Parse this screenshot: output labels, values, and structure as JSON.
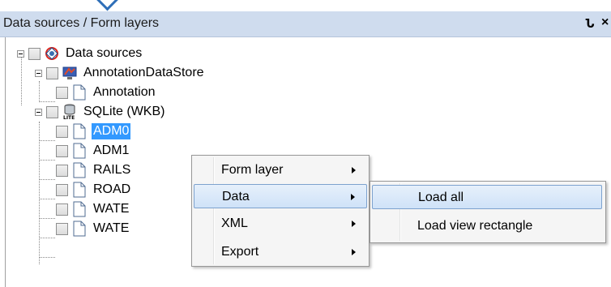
{
  "panel": {
    "title": "Data sources / Form layers",
    "pin_glyph": "Ն",
    "close_glyph": "×"
  },
  "tree": {
    "root": {
      "label": "Data sources",
      "icon": "data-sources-icon"
    },
    "groups": [
      {
        "label": "AnnotationDataStore",
        "icon": "annotation-store-icon",
        "children": [
          {
            "label": "Annotation",
            "icon": "document-icon"
          }
        ]
      },
      {
        "label": "SQLite (WKB)",
        "icon": "sqlite-database-icon",
        "children": [
          {
            "label": "ADM0",
            "icon": "document-icon",
            "selected": true
          },
          {
            "label": "ADM1",
            "icon": "document-icon"
          },
          {
            "label": "RAILS",
            "icon": "document-icon"
          },
          {
            "label": "ROAD",
            "icon": "document-icon"
          },
          {
            "label": "WATE",
            "icon": "document-icon"
          },
          {
            "label": "WATE",
            "icon": "document-icon"
          }
        ]
      }
    ]
  },
  "context_menu": {
    "items": [
      {
        "label": "Form layer",
        "has_submenu": true
      },
      {
        "label": "Data",
        "has_submenu": true,
        "highlighted": true
      },
      {
        "label": "XML",
        "has_submenu": true
      },
      {
        "label": "Export",
        "has_submenu": true
      }
    ]
  },
  "submenu": {
    "items": [
      {
        "label": "Load all",
        "highlighted": true
      },
      {
        "label": "Load view rectangle"
      }
    ]
  },
  "colors": {
    "title_bar": "#cfdcee",
    "selection": "#3399ff",
    "menu_highlight_border": "#7da2ce"
  }
}
